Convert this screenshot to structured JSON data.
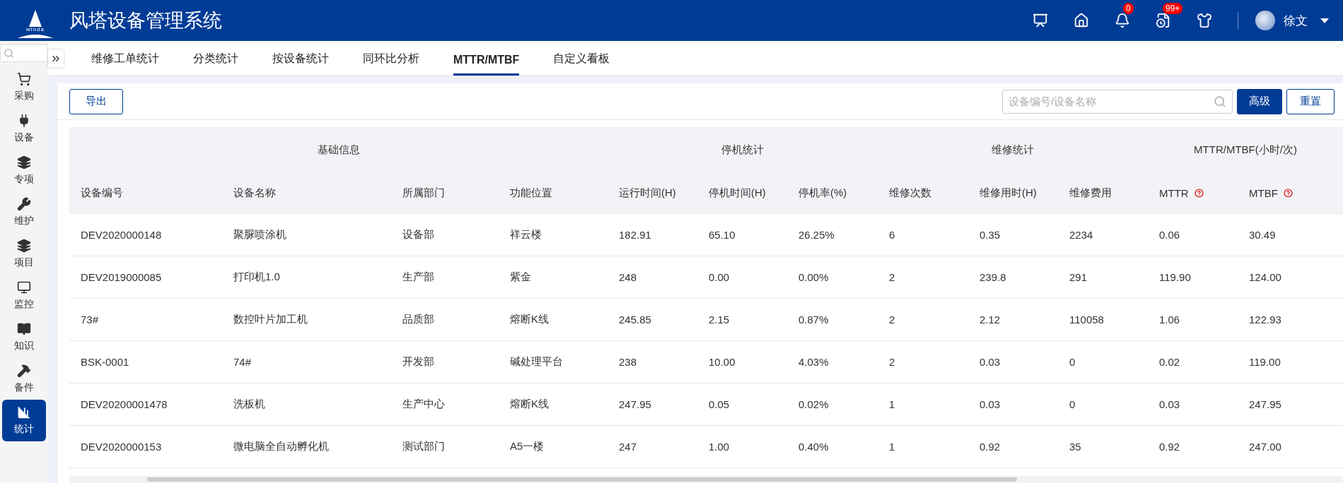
{
  "header": {
    "title": "风塔设备管理系统",
    "logo_text": "winda",
    "notifications": "0",
    "messages": "99+",
    "user": "徐文"
  },
  "sidebar": {
    "items": [
      {
        "label": "采购",
        "selected": false
      },
      {
        "label": "设备",
        "selected": false
      },
      {
        "label": "专项",
        "selected": false
      },
      {
        "label": "维护",
        "selected": false
      },
      {
        "label": "项目",
        "selected": false
      },
      {
        "label": "监控",
        "selected": false
      },
      {
        "label": "知识",
        "selected": false
      },
      {
        "label": "备件",
        "selected": false
      },
      {
        "label": "统计",
        "selected": true
      }
    ]
  },
  "tabs": [
    {
      "label": "维修工单统计",
      "selected": false
    },
    {
      "label": "分类统计",
      "selected": false
    },
    {
      "label": "按设备统计",
      "selected": false
    },
    {
      "label": "同环比分析",
      "selected": false
    },
    {
      "label": "MTTR/MTBF",
      "selected": true
    },
    {
      "label": "自定义看板",
      "selected": false
    }
  ],
  "toolbar": {
    "export": "导出",
    "search": {
      "placeholder": "设备编号/设备名称"
    },
    "advanced": "高级",
    "reset": "重置"
  },
  "table": {
    "groups": [
      "基础信息",
      "停机统计",
      "维修统计",
      "MTTR/MTBF(小时/次)"
    ],
    "columns": [
      {
        "label": "设备编号",
        "help": false
      },
      {
        "label": "设备名称",
        "help": false
      },
      {
        "label": "所属部门",
        "help": false
      },
      {
        "label": "功能位置",
        "help": false
      },
      {
        "label": "运行时间(H)",
        "help": false
      },
      {
        "label": "停机时间(H)",
        "help": false
      },
      {
        "label": "停机率(%)",
        "help": false
      },
      {
        "label": "维修次数",
        "help": false
      },
      {
        "label": "维修用时(H)",
        "help": false
      },
      {
        "label": "维修费用",
        "help": false
      },
      {
        "label": "MTTR",
        "help": true
      },
      {
        "label": "MTBF",
        "help": true
      }
    ],
    "rows": [
      [
        "DEV2020000148",
        "聚脲喷涂机",
        "设备部",
        "祥云楼",
        "182.91",
        "65.10",
        "26.25%",
        "6",
        "0.35",
        "2234",
        "0.06",
        "30.49"
      ],
      [
        "DEV2019000085",
        "打印机1.0",
        "生产部",
        "紫金",
        "248",
        "0.00",
        "0.00%",
        "2",
        "239.8",
        "291",
        "119.90",
        "124.00"
      ],
      [
        "73#",
        "数控叶片加工机",
        "品质部",
        "熔断K线",
        "245.85",
        "2.15",
        "0.87%",
        "2",
        "2.12",
        "110058",
        "1.06",
        "122.93"
      ],
      [
        "BSK-0001",
        "74#",
        "开发部",
        "碱处理平台",
        "238",
        "10.00",
        "4.03%",
        "2",
        "0.03",
        "0",
        "0.02",
        "119.00"
      ],
      [
        "DEV20200001478",
        "洗板机",
        "生产中心",
        "熔断K线",
        "247.95",
        "0.05",
        "0.02%",
        "1",
        "0.03",
        "0",
        "0.03",
        "247.95"
      ],
      [
        "DEV2020000153",
        "微电脑全自动孵化机",
        "测试部门",
        "A5一楼",
        "247",
        "1.00",
        "0.40%",
        "1",
        "0.92",
        "35",
        "0.92",
        "247.00"
      ]
    ]
  }
}
